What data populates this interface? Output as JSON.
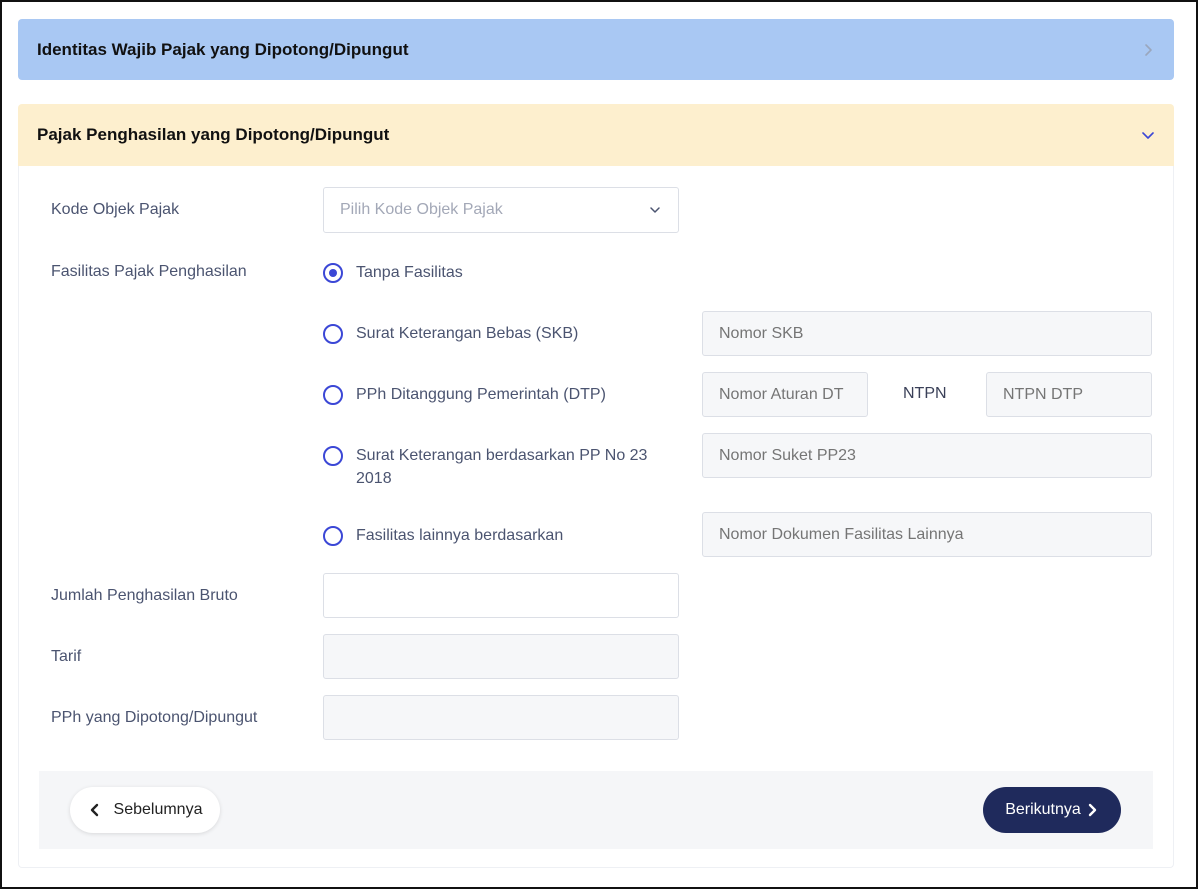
{
  "sections": {
    "identity": {
      "title": "Identitas Wajib Pajak yang Dipotong/Dipungut"
    },
    "income_tax": {
      "title": "Pajak Penghasilan yang Dipotong/Dipungut"
    }
  },
  "form": {
    "kode_objek": {
      "label": "Kode Objek Pajak",
      "placeholder": "Pilih Kode Objek Pajak"
    },
    "fasilitas": {
      "label": "Fasilitas Pajak Penghasilan",
      "options": [
        {
          "label": "Tanpa Fasilitas",
          "selected": true
        },
        {
          "label": "Surat Keterangan Bebas (SKB)",
          "selected": false,
          "input_placeholder": "Nomor SKB"
        },
        {
          "label": "PPh Ditanggung Pemerintah (DTP)",
          "selected": false,
          "input_placeholder": "Nomor Aturan DT",
          "extra_label": "NTPN",
          "extra_placeholder": "NTPN DTP"
        },
        {
          "label": "Surat Keterangan berdasarkan PP No 23 2018",
          "selected": false,
          "input_placeholder": "Nomor Suket PP23"
        },
        {
          "label": "Fasilitas lainnya berdasarkan",
          "selected": false,
          "input_placeholder": "Nomor Dokumen Fasilitas Lainnya"
        }
      ]
    },
    "bruto": {
      "label": "Jumlah Penghasilan Bruto",
      "value": ""
    },
    "tarif": {
      "label": "Tarif",
      "value": ""
    },
    "pph": {
      "label": "PPh yang Dipotong/Dipungut",
      "value": ""
    }
  },
  "nav": {
    "prev_label": "Sebelumnya",
    "next_label": "Berikutnya"
  },
  "colors": {
    "accent": "#3b47d6",
    "primary_button": "#1f2a5c",
    "identity_header": "#a9c8f3",
    "income_header": "#fdefce"
  }
}
